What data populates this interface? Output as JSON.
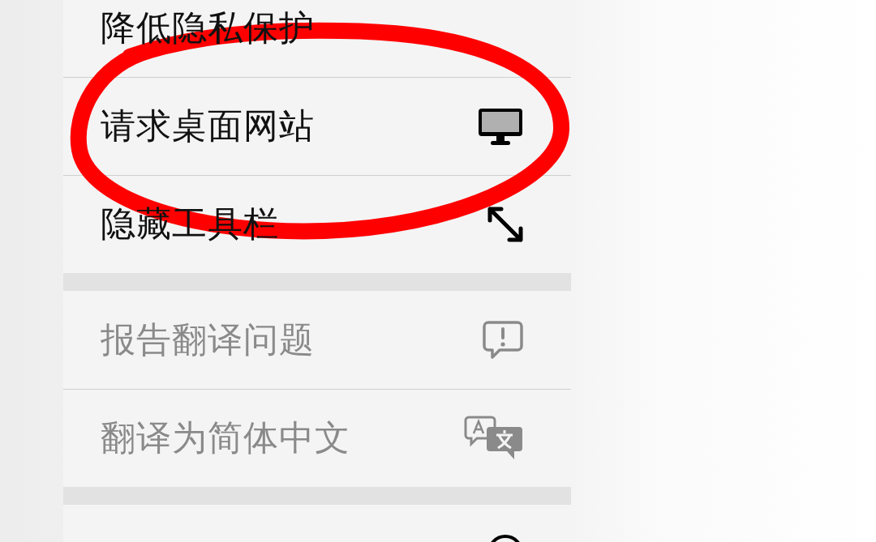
{
  "groups": [
    {
      "items": [
        {
          "label": "降低隐私保护",
          "kind": "none",
          "disabled": false
        },
        {
          "label": "请求桌面网站",
          "kind": "desktop",
          "disabled": false
        },
        {
          "label": "隐藏工具栏",
          "kind": "resize",
          "disabled": false
        }
      ]
    },
    {
      "items": [
        {
          "label": "报告翻译问题",
          "kind": "report",
          "disabled": true
        },
        {
          "label": "翻译为简体中文",
          "kind": "translate",
          "disabled": true
        }
      ]
    },
    {
      "items": [
        {
          "kind": "round"
        }
      ]
    }
  ]
}
